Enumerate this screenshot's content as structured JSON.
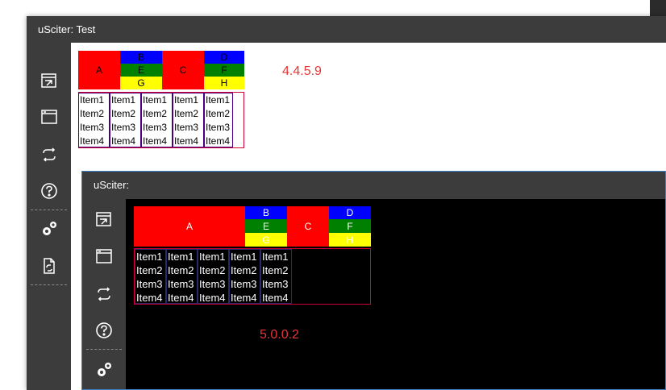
{
  "window1": {
    "title": "uSciter: Test",
    "version": "4.4.5.9"
  },
  "window2": {
    "title": "uSciter:",
    "version": "5.0.0.2"
  },
  "sidebar_icons": [
    "open-file-icon",
    "window-icon",
    "reload-icon",
    "help-icon",
    "settings-icon",
    "refresh-document-icon"
  ],
  "cells": {
    "a": "A",
    "b": "B",
    "c": "C",
    "d": "D",
    "e": "E",
    "f": "F",
    "g": "G",
    "h": "H"
  },
  "list_items": [
    "Item1",
    "Item2",
    "Item3",
    "Item4"
  ],
  "colors": {
    "red": "#ff0000",
    "blue": "#0000ff",
    "green": "#008000",
    "yellow": "#ffff00",
    "version_text": "#e83535",
    "list_border_outer": "#cc0033",
    "list_border_inner": "#4b0082"
  }
}
